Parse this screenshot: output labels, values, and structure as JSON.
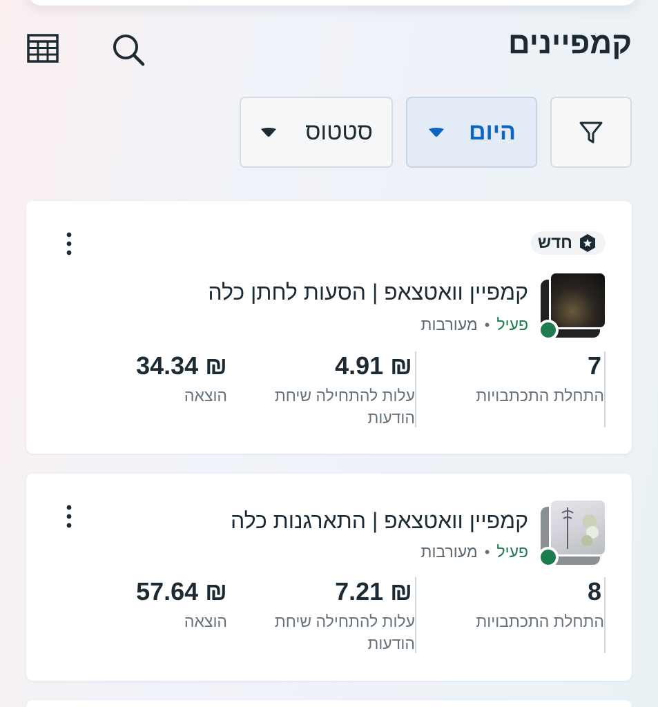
{
  "header": {
    "title": "קמפיינים",
    "icons": [
      "table-icon",
      "search-icon"
    ]
  },
  "filters": {
    "filter_icon": "filter-icon",
    "date_label": "היום",
    "status_label": "סטטוס"
  },
  "colors": {
    "accent": "#0a66c2",
    "active_green": "#1e7a4f",
    "text_dark": "#1c2b33",
    "text_muted": "#65727c"
  },
  "campaigns": [
    {
      "badge": "חדש",
      "title": "קמפיין וואטצאפ | הסעות לחתן כלה",
      "status": "פעיל",
      "objective": "מעורבות",
      "metrics": [
        {
          "value": "7",
          "label": "התחלת התכתבויות"
        },
        {
          "value": "₪ 4.91",
          "label": "עלות להתחילה שיחת הודעות"
        },
        {
          "value": "₪ 34.34",
          "label": "הוצאה"
        }
      ]
    },
    {
      "title": "קמפיין וואטצאפ | התארגנות כלה",
      "status": "פעיל",
      "objective": "מעורבות",
      "metrics": [
        {
          "value": "8",
          "label": "התחלת התכתבויות"
        },
        {
          "value": "₪ 7.21",
          "label": "עלות להתחילה שיחת הודעות"
        },
        {
          "value": "₪ 57.64",
          "label": "הוצאה"
        }
      ]
    }
  ]
}
